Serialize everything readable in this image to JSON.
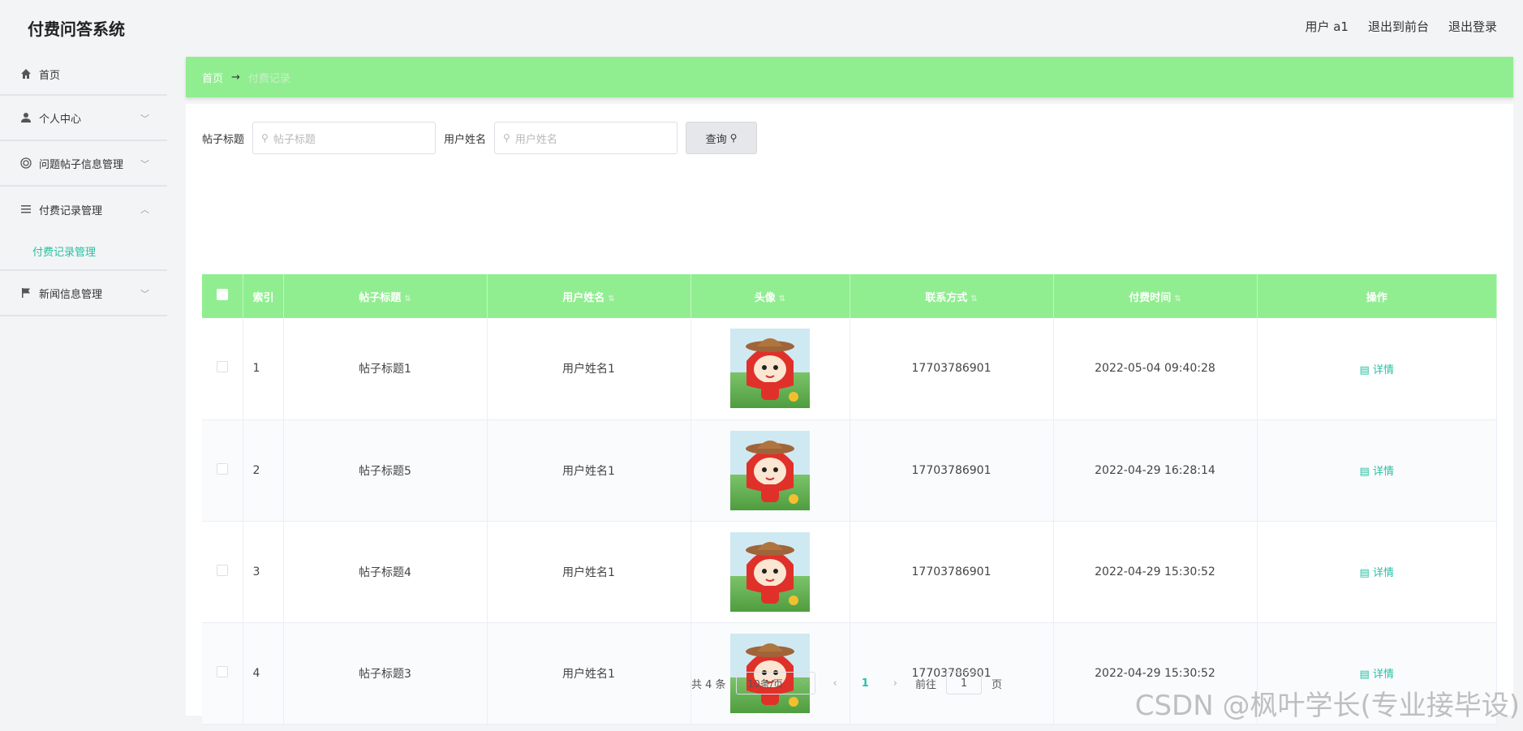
{
  "app": {
    "title": "付费问答系统"
  },
  "top_links": {
    "user": "用户 a1",
    "front": "退出到前台",
    "logout": "退出登录"
  },
  "sidebar": {
    "items": [
      {
        "label": "首页",
        "icon": "home-icon"
      },
      {
        "label": "个人中心",
        "icon": "user-icon"
      },
      {
        "label": "问题帖子信息管理",
        "icon": "circle-icon"
      },
      {
        "label": "付费记录管理",
        "icon": "list-icon",
        "sub": "付费记录管理"
      },
      {
        "label": "新闻信息管理",
        "icon": "flag-icon"
      }
    ]
  },
  "breadcrumb": {
    "home": "首页",
    "arrow": "→",
    "current": "付费记录"
  },
  "search": {
    "title_label": "帖子标题",
    "title_placeholder": "帖子标题",
    "user_label": "用户姓名",
    "user_placeholder": "用户姓名",
    "query_button": "查询"
  },
  "table": {
    "headers": {
      "index": "索引",
      "title": "帖子标题",
      "user": "用户姓名",
      "avatar": "头像",
      "phone": "联系方式",
      "time": "付费时间",
      "ops": "操作"
    },
    "rows": [
      {
        "index": "1",
        "title": "帖子标题1",
        "user": "用户姓名1",
        "phone": "17703786901",
        "time": "2022-05-04 09:40:28",
        "action": "详情"
      },
      {
        "index": "2",
        "title": "帖子标题5",
        "user": "用户姓名1",
        "phone": "17703786901",
        "time": "2022-04-29 16:28:14",
        "action": "详情"
      },
      {
        "index": "3",
        "title": "帖子标题4",
        "user": "用户姓名1",
        "phone": "17703786901",
        "time": "2022-04-29 15:30:52",
        "action": "详情"
      },
      {
        "index": "4",
        "title": "帖子标题3",
        "user": "用户姓名1",
        "phone": "17703786901",
        "time": "2022-04-29 15:30:52",
        "action": "详情"
      }
    ]
  },
  "pager": {
    "total": "共 4 条",
    "size": "10条/页",
    "page": "1",
    "goto": "前往",
    "goto_value": "1",
    "page_unit": "页"
  },
  "watermark": "CSDN @枫叶学长(专业接毕设)",
  "colors": {
    "accent": "#90ee90",
    "link": "#27c0a4"
  }
}
